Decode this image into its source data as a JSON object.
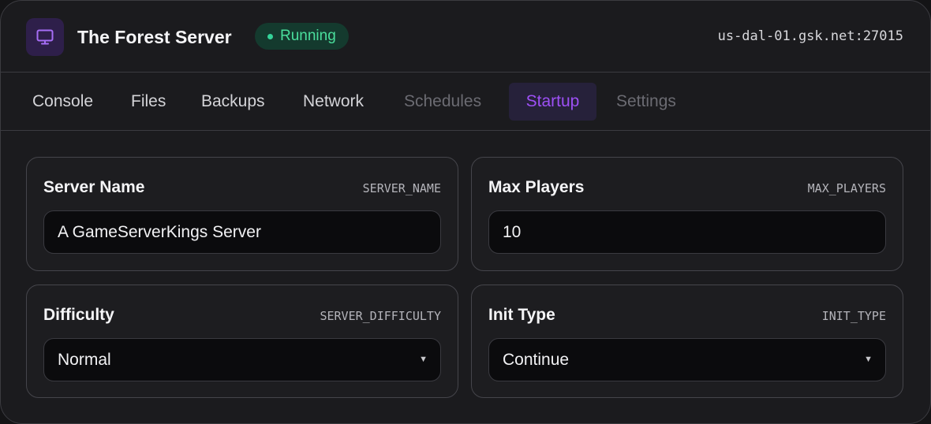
{
  "header": {
    "title": "The Forest Server",
    "status": "Running",
    "address": "us-dal-01.gsk.net:27015",
    "icon": "monitor-icon"
  },
  "tabs": [
    {
      "label": "Console",
      "state": "normal"
    },
    {
      "label": "Files",
      "state": "normal"
    },
    {
      "label": "Backups",
      "state": "normal"
    },
    {
      "label": "Network",
      "state": "normal"
    },
    {
      "label": "Schedules",
      "state": "disabled"
    },
    {
      "label": "Startup",
      "state": "active"
    },
    {
      "label": "Settings",
      "state": "disabled"
    }
  ],
  "variables": {
    "server_name": {
      "label": "Server Name",
      "env": "SERVER_NAME",
      "value": "A GameServerKings Server"
    },
    "max_players": {
      "label": "Max Players",
      "env": "MAX_PLAYERS",
      "value": "10"
    },
    "difficulty": {
      "label": "Difficulty",
      "env": "SERVER_DIFFICULTY",
      "value": "Normal",
      "icon": "chevron-down-icon"
    },
    "init_type": {
      "label": "Init Type",
      "env": "INIT_TYPE",
      "value": "Continue",
      "icon": "chevron-down-icon"
    }
  },
  "colors": {
    "accent": "#9d50f5",
    "status_green": "#4ade9c",
    "background": "#1b1b1e"
  }
}
